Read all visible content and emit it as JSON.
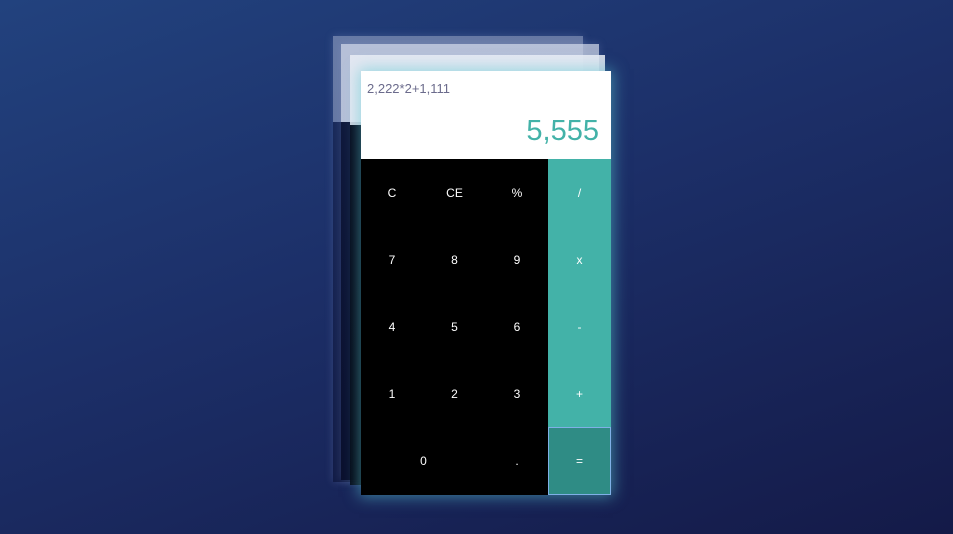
{
  "display": {
    "expression": "2,222*2+1,111",
    "result": "5,555"
  },
  "keys": {
    "clear": "C",
    "clear_entry": "CE",
    "percent": "%",
    "divide": "/",
    "seven": "7",
    "eight": "8",
    "nine": "9",
    "multiply": "x",
    "four": "4",
    "five": "5",
    "six": "6",
    "subtract": "-",
    "one": "1",
    "two": "2",
    "three": "3",
    "add": "+",
    "zero": "0",
    "decimal": ".",
    "equals": "="
  },
  "colors": {
    "accent": "#43b2a8",
    "equals_bg": "#2f8c85",
    "keypad_bg": "#000000",
    "display_bg": "#ffffff"
  }
}
